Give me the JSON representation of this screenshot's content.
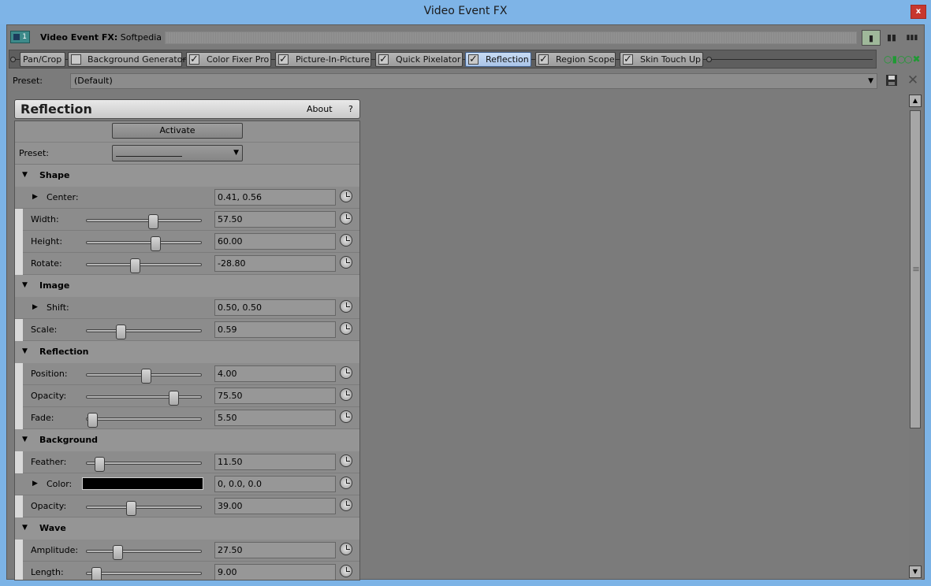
{
  "window": {
    "title": "Video Event FX",
    "close_glyph": "x"
  },
  "header": {
    "track_number": "1",
    "fx_label_bold": "Video Event FX:",
    "fx_label_source": "Softpedia"
  },
  "chain": {
    "plugins": [
      {
        "label": "Pan/Crop",
        "checkbox": false,
        "checked": false,
        "active": false
      },
      {
        "label": "Background Generator",
        "checkbox": true,
        "checked": false,
        "active": false
      },
      {
        "label": "Color Fixer Pro",
        "checkbox": true,
        "checked": true,
        "active": false
      },
      {
        "label": "Picture-In-Picture",
        "checkbox": true,
        "checked": true,
        "active": false
      },
      {
        "label": "Quick Pixelator",
        "checkbox": true,
        "checked": true,
        "active": false
      },
      {
        "label": "Reflection",
        "checkbox": true,
        "checked": true,
        "active": true
      },
      {
        "label": "Region Scope",
        "checkbox": true,
        "checked": true,
        "active": false
      },
      {
        "label": "Skin Touch Up",
        "checkbox": true,
        "checked": true,
        "active": false
      }
    ]
  },
  "preset_bar": {
    "label": "Preset:",
    "value": "(Default)"
  },
  "panel": {
    "title": "Reflection",
    "about": "About",
    "help": "?",
    "activate": "Activate",
    "preset_label": "Preset:",
    "sections": {
      "shape": {
        "name": "Shape",
        "center_label": "Center:",
        "center_value": "0.41, 0.56",
        "width_label": "Width:",
        "width_value": "57.50",
        "width_pos": 0.575,
        "height_label": "Height:",
        "height_value": "60.00",
        "height_pos": 0.6,
        "rotate_label": "Rotate:",
        "rotate_value": "-28.80",
        "rotate_pos": 0.42
      },
      "image": {
        "name": "Image",
        "shift_label": "Shift:",
        "shift_value": "0.50, 0.50",
        "scale_label": "Scale:",
        "scale_value": "0.59",
        "scale_pos": 0.3
      },
      "reflection": {
        "name": "Reflection",
        "position_label": "Position:",
        "position_value": "4.00",
        "position_pos": 0.52,
        "opacity_label": "Opacity:",
        "opacity_value": "75.50",
        "opacity_pos": 0.755,
        "fade_label": "Fade:",
        "fade_value": "5.50",
        "fade_pos": 0.055
      },
      "background": {
        "name": "Background",
        "feather_label": "Feather:",
        "feather_value": "11.50",
        "feather_pos": 0.115,
        "color_label": "Color:",
        "color_value": "0, 0.0, 0.0",
        "color_swatch": "#000000",
        "opacity_label": "Opacity:",
        "opacity_value": "39.00",
        "opacity_pos": 0.39
      },
      "wave": {
        "name": "Wave",
        "amplitude_label": "Amplitude:",
        "amplitude_value": "27.50",
        "amplitude_pos": 0.275,
        "length_label": "Length:",
        "length_value": "9.00",
        "length_pos": 0.09
      }
    }
  },
  "icons": {
    "close": "close-icon",
    "keyframe": "stopwatch-icon",
    "save": "save-icon",
    "delete": "delete-icon",
    "expand": "triangle-icon"
  },
  "colors": {
    "active_tab": "#a9c4e8",
    "chain_icon": "#1f9a34",
    "close_button": "#c7372e"
  }
}
